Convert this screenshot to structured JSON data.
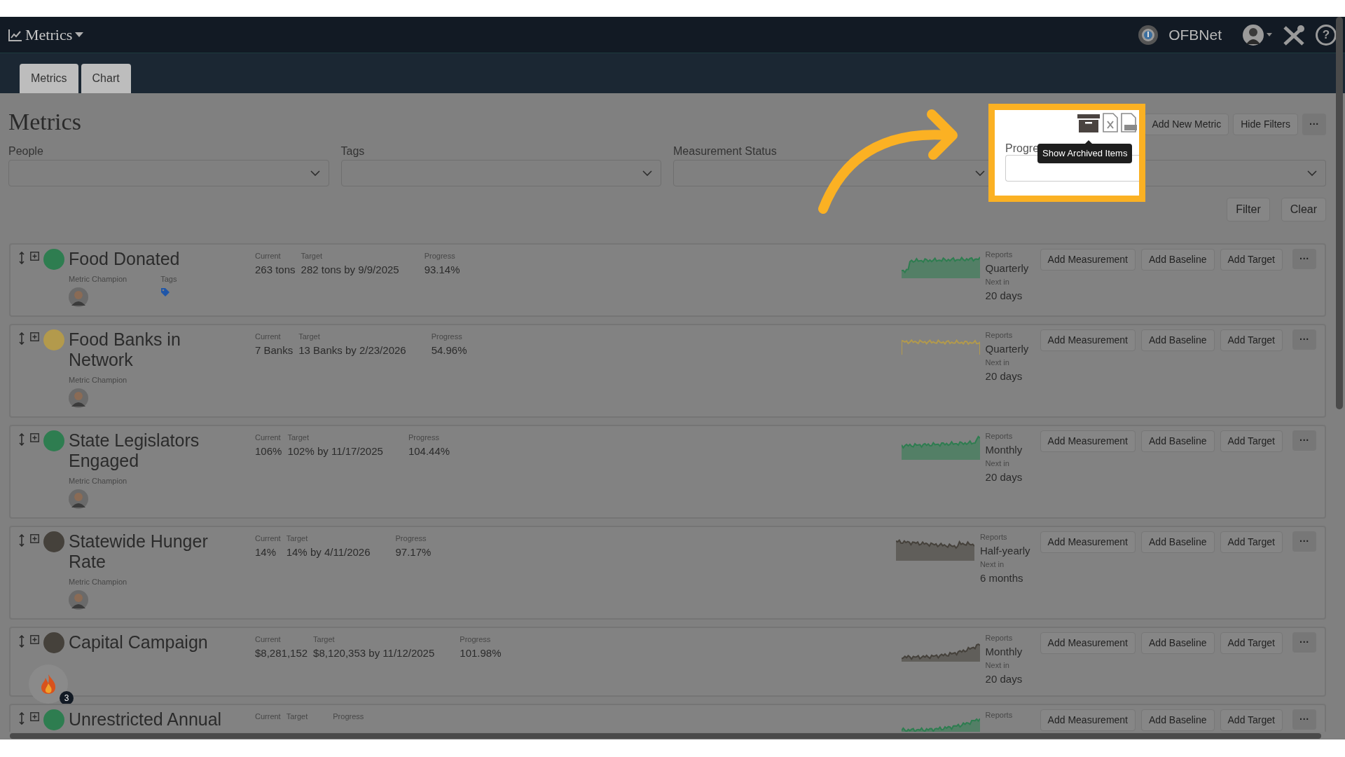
{
  "nav": {
    "title": "Metrics",
    "org": "OFBNet",
    "help": "?"
  },
  "tabs": [
    {
      "label": "Metrics"
    },
    {
      "label": "Chart"
    }
  ],
  "page_title": "Metrics",
  "filters": [
    {
      "label": "People"
    },
    {
      "label": "Tags"
    },
    {
      "label": "Measurement Status"
    },
    {
      "label": "Progre"
    }
  ],
  "toolbar": {
    "tooltip": "Show Archived Items",
    "buttons": [
      "Add New Metric",
      "Hide Filters",
      "···"
    ]
  },
  "filter_buttons": [
    "Filter",
    "Clear"
  ],
  "metrics": [
    {
      "title": "Food Donated",
      "color": "#2e7d50",
      "sparkline_filled": true,
      "champion_label": "Metric Champion",
      "tags_label": "Tags",
      "current_label": "Current",
      "current": "263 tons",
      "target_label": "Target",
      "target": "282 tons by 9/9/2025",
      "progress_label": "Progress",
      "progress": "93.14%",
      "reports_label": "Reports",
      "frequency": "Quarterly",
      "next_label": "Next in",
      "next": "20 days",
      "actions": [
        "Add Measurement",
        "Add Baseline",
        "Add Target",
        "···"
      ]
    },
    {
      "title": "Food Banks in Network",
      "color": "#b39a4c",
      "sparkline_filled": false,
      "champion_label": "Metric Champion",
      "current_label": "Current",
      "current": "7 Banks",
      "target_label": "Target",
      "target": "13 Banks by 2/23/2026",
      "progress_label": "Progress",
      "progress": "54.96%",
      "reports_label": "Reports",
      "frequency": "Quarterly",
      "next_label": "Next in",
      "next": "20 days",
      "actions": [
        "Add Measurement",
        "Add Baseline",
        "Add Target",
        "···"
      ]
    },
    {
      "title": "State Legislators Engaged",
      "color": "#2e7d50",
      "sparkline_filled": true,
      "champion_label": "Metric Champion",
      "current_label": "Current",
      "current": "106%",
      "target_label": "Target",
      "target": "102% by 11/17/2025",
      "progress_label": "Progress",
      "progress": "104.44%",
      "reports_label": "Reports",
      "frequency": "Monthly",
      "next_label": "Next in",
      "next": "20 days",
      "actions": [
        "Add Measurement",
        "Add Baseline",
        "Add Target",
        "···"
      ]
    },
    {
      "title": "Statewide Hunger Rate",
      "color": "#45413b",
      "sparkline_filled": true,
      "champion_label": "Metric Champion",
      "current_label": "Current",
      "current": "14%",
      "target_label": "Target",
      "target": "14% by 4/11/2026",
      "progress_label": "Progress",
      "progress": "97.17%",
      "reports_label": "Reports",
      "frequency": "Half-yearly",
      "next_label": "Next in",
      "next": "6 months",
      "actions": [
        "Add Measurement",
        "Add Baseline",
        "Add Target",
        "···"
      ]
    },
    {
      "title": "Capital Campaign",
      "color": "#45413b",
      "sparkline_filled": true,
      "current_label": "Current",
      "current": "$8,281,152",
      "target_label": "Target",
      "target": "$8,120,353 by 11/12/2025",
      "progress_label": "Progress",
      "progress": "101.98%",
      "reports_label": "Reports",
      "frequency": "Monthly",
      "next_label": "Next in",
      "next": "20 days",
      "actions": [
        "Add Measurement",
        "Add Baseline",
        "Add Target",
        "···"
      ]
    },
    {
      "title": "Unrestricted Annual",
      "color": "#2e7d50",
      "sparkline_filled": true,
      "current_label": "Current",
      "target_label": "Target",
      "progress_label": "Progress",
      "reports_label": "Reports",
      "actions": [
        "Add Measurement",
        "Add Baseline",
        "Add Target",
        "···"
      ]
    }
  ],
  "notification_widget": {
    "badge": "3"
  }
}
